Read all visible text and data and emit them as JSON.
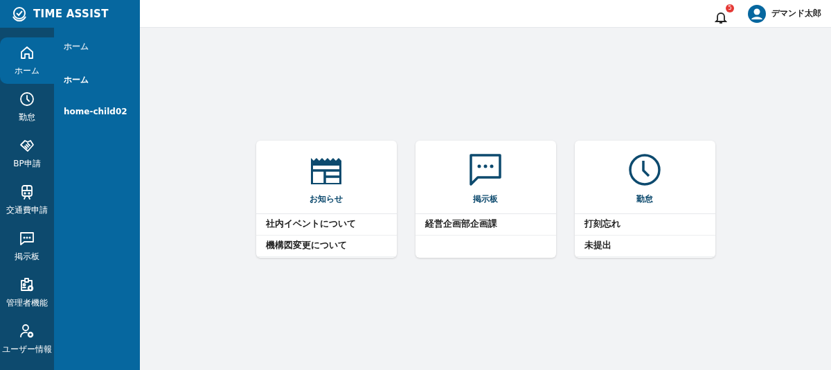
{
  "brand": {
    "title": "TIME ASSIST"
  },
  "header": {
    "notification_count": "5",
    "user_name": "デマンド太郎"
  },
  "rail": [
    {
      "label": "ホーム",
      "kind": "home",
      "selected": true
    },
    {
      "label": "勤怠",
      "kind": "clock",
      "selected": false
    },
    {
      "label": "BP申請",
      "kind": "handshake",
      "selected": false
    },
    {
      "label": "交通費申請",
      "kind": "train",
      "selected": false
    },
    {
      "label": "掲示板",
      "kind": "chat",
      "selected": false
    },
    {
      "label": "管理者機能",
      "kind": "badge",
      "selected": false
    },
    {
      "label": "ユーザー情報",
      "kind": "user",
      "selected": false
    }
  ],
  "submenu": {
    "heading": "ホーム",
    "items": [
      {
        "label": "ホーム"
      },
      {
        "label": "home-child02"
      }
    ]
  },
  "cards": [
    {
      "title": "お知らせ",
      "kind": "news",
      "items": [
        "社内イベントについて",
        "機構図変更について"
      ]
    },
    {
      "title": "掲示板",
      "kind": "chat",
      "items": [
        "経営企画部企画課"
      ]
    },
    {
      "title": "勤怠",
      "kind": "clock",
      "items": [
        "打刻忘れ",
        "未提出"
      ]
    }
  ]
}
